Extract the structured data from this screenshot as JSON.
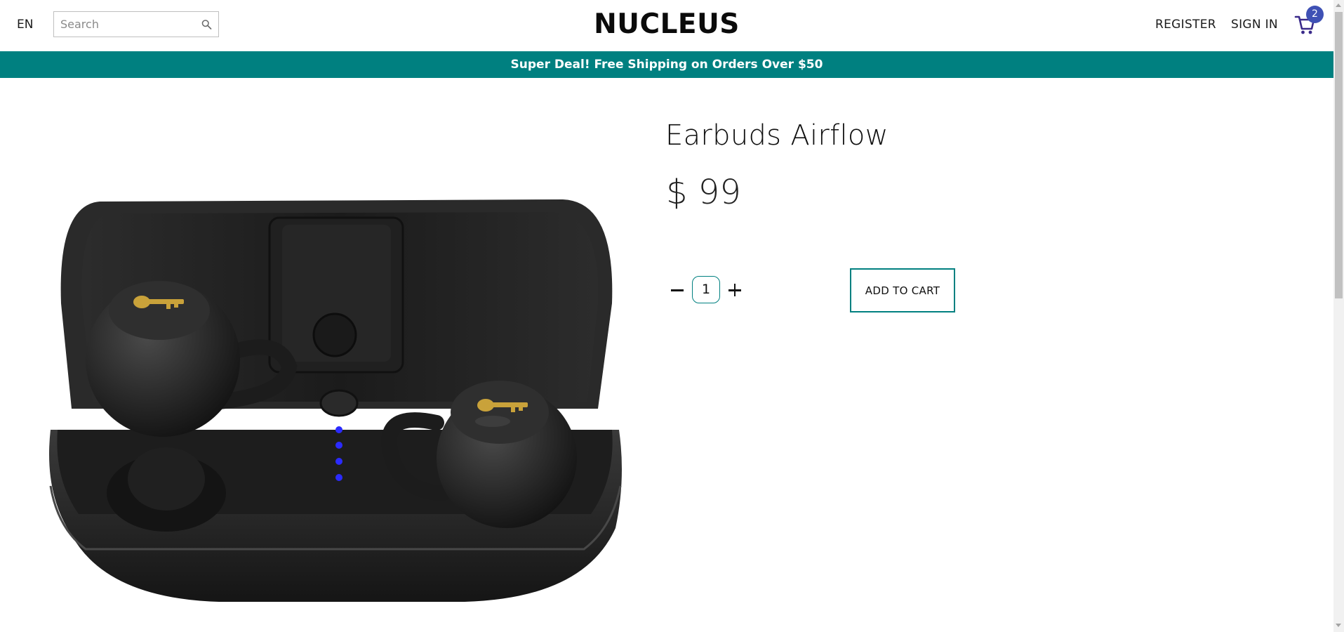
{
  "header": {
    "language": "EN",
    "search": {
      "placeholder": "Search",
      "value": ""
    },
    "logo": "NUCLEUS",
    "register": "REGISTER",
    "sign_in": "SIGN IN",
    "cart_count": "2"
  },
  "banner": {
    "text": "Super Deal! Free Shipping on Orders Over $50"
  },
  "product": {
    "title": "Earbuds Airflow",
    "price": "$ 99",
    "quantity": "1",
    "add_to_cart": "ADD TO CART",
    "image": "earbuds-charging-case"
  },
  "colors": {
    "accent": "#008080",
    "badge": "#3f51b5",
    "cart_icon": "#3a2a8a",
    "led": "#2b2bff",
    "logo_gold": "#c9a23a"
  }
}
